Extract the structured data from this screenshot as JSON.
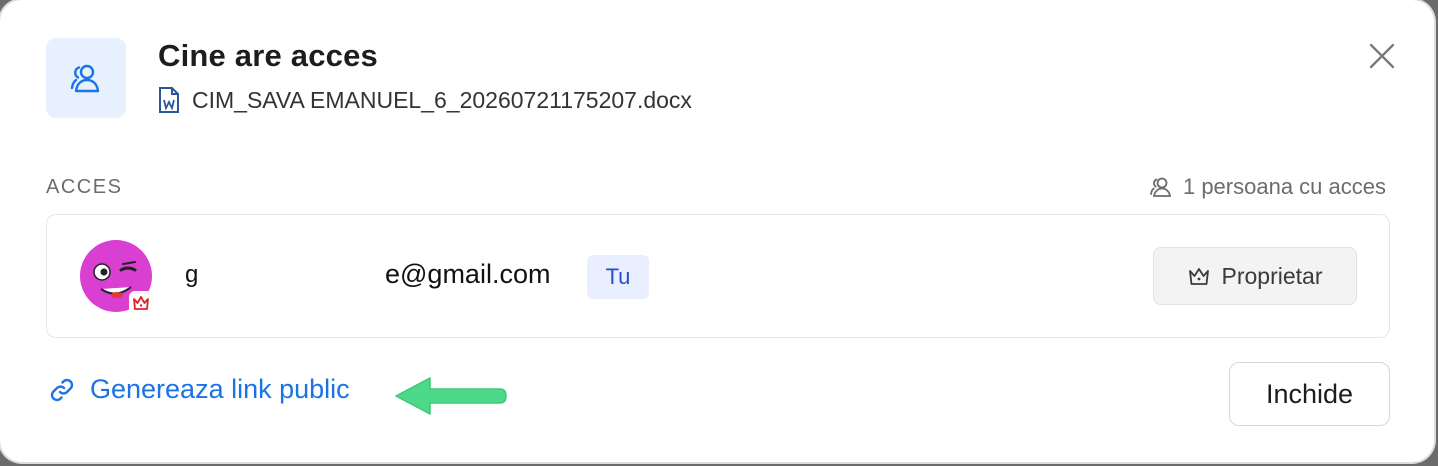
{
  "dialog": {
    "title": "Cine are acces",
    "file_name": "CIM_SAVA EMANUEL_6_20260721175207.docx",
    "file_icon": "word-doc-icon",
    "close_icon": "close-icon"
  },
  "access": {
    "section_label": "ACCES",
    "count_text": "1 persoana cu acces",
    "users": [
      {
        "email_prefix": "g",
        "email_suffix": "e@gmail.com",
        "badge": "Tu",
        "role": "Proprietar",
        "avatar_icon": "winking-face-avatar",
        "role_icon": "crown-icon"
      }
    ]
  },
  "footer": {
    "public_link_label": "Genereaza link public",
    "link_icon": "link-icon",
    "close_label": "Inchide"
  },
  "colors": {
    "accent": "#1a73e8",
    "badge_bg": "#e9efff",
    "annotation_arrow": "#4cd98a",
    "avatar": "#d93fd0"
  }
}
